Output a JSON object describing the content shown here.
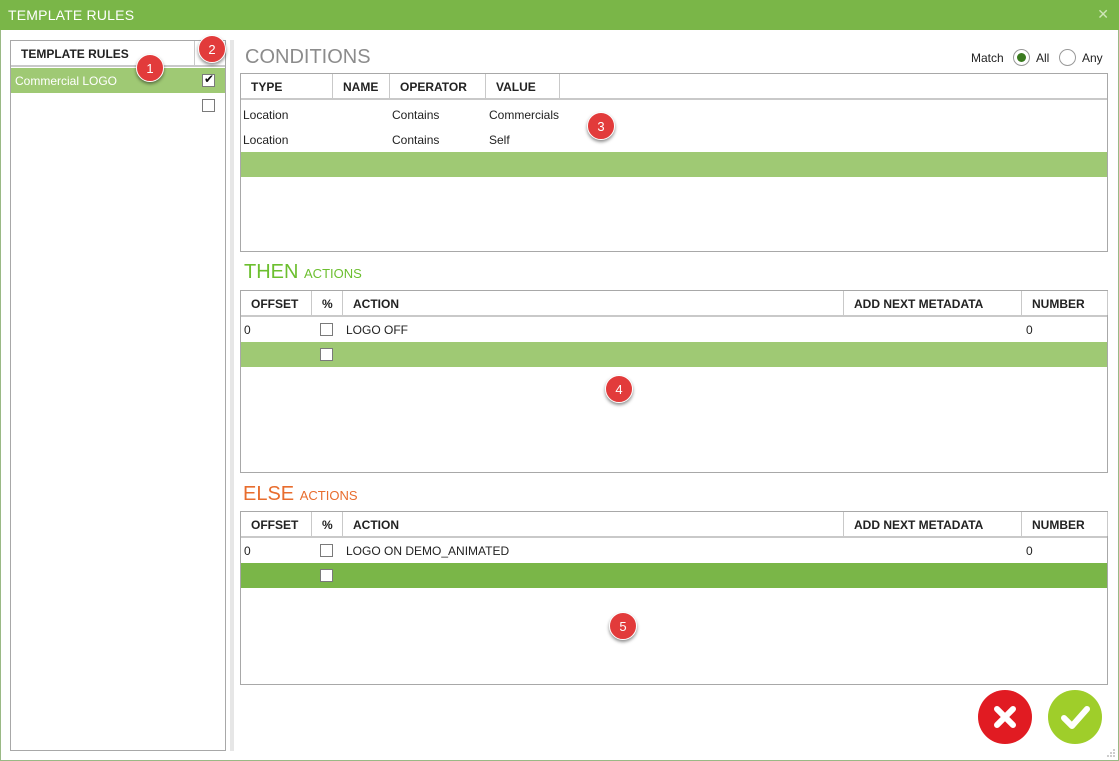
{
  "window": {
    "title": "TEMPLATE RULES",
    "close_glyph": "✕"
  },
  "rules_panel": {
    "header": "TEMPLATE RULES",
    "items": [
      {
        "label": "Commercial LOGO",
        "checked": true,
        "selected": true
      },
      {
        "label": "",
        "checked": false,
        "selected": false
      }
    ]
  },
  "conditions": {
    "title": "CONDITIONS",
    "match_label": "Match",
    "match_options": [
      "All",
      "Any"
    ],
    "match_selected": "All",
    "columns": [
      "TYPE",
      "NAME",
      "OPERATOR",
      "VALUE"
    ],
    "rows": [
      {
        "type": "Location",
        "name": "",
        "operator": "Contains",
        "value": "Commercials"
      },
      {
        "type": "Location",
        "name": "",
        "operator": "Contains",
        "value": "Self"
      }
    ]
  },
  "then_actions": {
    "title": "THEN",
    "subtitle": "ACTIONS",
    "columns": [
      "OFFSET",
      "%",
      "ACTION",
      "ADD NEXT METADATA",
      "NUMBER"
    ],
    "rows": [
      {
        "offset": "0",
        "percent": false,
        "action": "LOGO OFF",
        "metadata": "",
        "number": "0"
      }
    ]
  },
  "else_actions": {
    "title": "ELSE",
    "subtitle": "ACTIONS",
    "columns": [
      "OFFSET",
      "%",
      "ACTION",
      "ADD NEXT METADATA",
      "NUMBER"
    ],
    "rows": [
      {
        "offset": "0",
        "percent": false,
        "action": "LOGO ON DEMO_ANIMATED",
        "metadata": "",
        "number": "0"
      }
    ]
  },
  "callouts": [
    "1",
    "2",
    "3",
    "4",
    "5"
  ],
  "buttons": {
    "cancel_icon": "close-icon",
    "ok_icon": "check-icon"
  },
  "colors": {
    "titlebar": "#7ab648",
    "selected_row": "#9fc974",
    "new_row_dark": "#7ab648",
    "then_accent": "#6cbf2f",
    "else_accent": "#e86d2e",
    "cancel": "#e11b22",
    "ok": "#9fce2a",
    "callout": "#e23b3b"
  }
}
